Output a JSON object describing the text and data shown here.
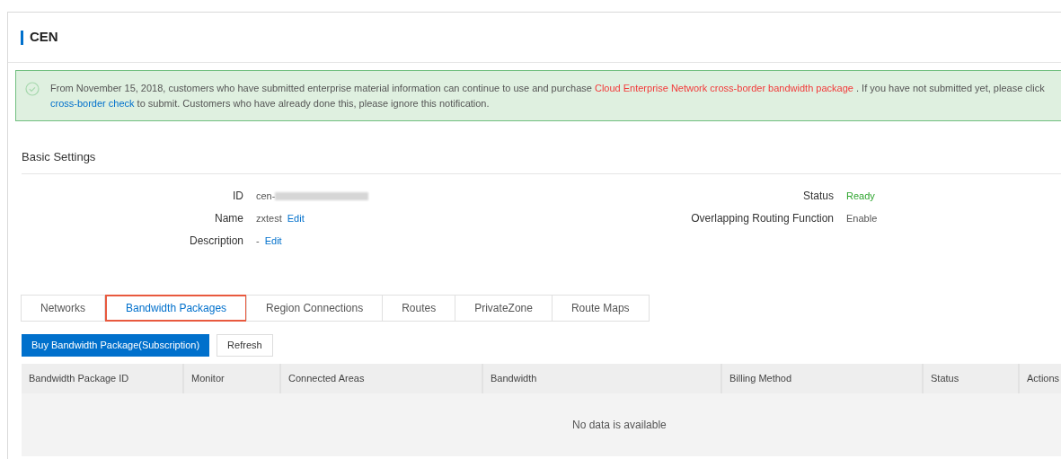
{
  "page": {
    "title": "CEN"
  },
  "notice": {
    "parts": [
      {
        "kind": "text",
        "text": "From November 15, 2018, customers who have submitted enterprise material information can continue to use and purchase "
      },
      {
        "kind": "warn_link",
        "text": "Cloud Enterprise Network cross-border bandwidth package"
      },
      {
        "kind": "text",
        "text": " . If you have not submitted yet, please click"
      },
      {
        "kind": "break"
      },
      {
        "kind": "link",
        "text": "cross-border check"
      },
      {
        "kind": "text",
        "text": " to submit. Customers who have already done this, please ignore this notification."
      }
    ]
  },
  "basic_settings": {
    "title": "Basic Settings",
    "left": [
      {
        "label": "ID",
        "value": "cen-",
        "blurred": true
      },
      {
        "label": "Name",
        "value": "zxtest",
        "action": "Edit"
      },
      {
        "label": "Description",
        "value": "-",
        "action": "Edit"
      }
    ],
    "right": [
      {
        "label": "Status",
        "value": "Ready",
        "kind": "status"
      },
      {
        "label": "Overlapping Routing Function",
        "value": "Enable",
        "kind": "plain"
      }
    ]
  },
  "tabs": [
    {
      "label": "Networks",
      "selected": false
    },
    {
      "label": "Bandwidth Packages",
      "selected": true
    },
    {
      "label": "Region Connections",
      "selected": false
    },
    {
      "label": "Routes",
      "selected": false
    },
    {
      "label": "PrivateZone",
      "selected": false
    },
    {
      "label": "Route Maps",
      "selected": false
    }
  ],
  "buttons": [
    {
      "label": "Buy Bandwidth Package(Subscription)",
      "kind": "primary"
    },
    {
      "label": "Refresh",
      "kind": "default"
    }
  ],
  "table": {
    "columns": [
      "Bandwidth Package ID",
      "Monitor",
      "Connected Areas",
      "Bandwidth",
      "Billing Method",
      "Status",
      "Actions"
    ],
    "empty_text": "No data is available"
  }
}
